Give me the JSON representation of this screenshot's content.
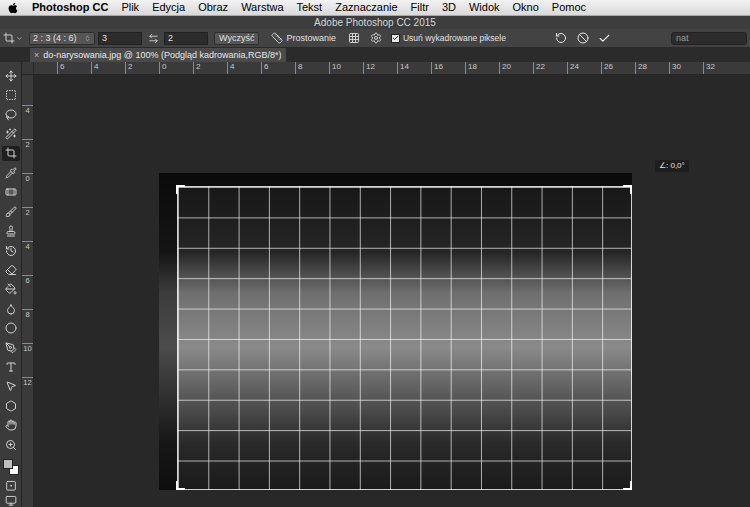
{
  "menu_bar": {
    "app_name": "Photoshop CC",
    "items": [
      "Plik",
      "Edycja",
      "Obraz",
      "Warstwa",
      "Tekst",
      "Zaznaczanie",
      "Filtr",
      "3D",
      "Widok",
      "Okno",
      "Pomoc"
    ]
  },
  "window": {
    "title": "Adobe Photoshop CC 2015"
  },
  "options_bar": {
    "ratio_preset": "2 : 3 (4 : 6)",
    "width": "3",
    "height": "2",
    "clear_button": "Wyczyść",
    "straighten_label": "Prostowanie",
    "delete_cropped": {
      "label": "Usuń wykadrowane piksele",
      "checked": true
    },
    "search": {
      "value": "nat"
    }
  },
  "document_tab": {
    "title": "do-narysowania.jpg @ 100% (Podgląd kadrowania,RGB/8*)",
    "close": "×",
    "selected": true
  },
  "rulers": {
    "horizontal": [
      "6",
      "4",
      "2",
      "0",
      "2",
      "4",
      "6",
      "8",
      "10",
      "12",
      "14",
      "16",
      "18",
      "20",
      "22",
      "24",
      "26",
      "28",
      "30",
      "32"
    ],
    "vertical": [
      "4",
      "2",
      "0",
      "2",
      "4",
      "6",
      "8",
      "10",
      "12"
    ]
  },
  "toolbar": {
    "tools": [
      {
        "selected": false
      },
      {
        "selected": false
      },
      {
        "selected": false
      },
      {
        "selected": false
      },
      {
        "selected": true
      },
      {
        "selected": false
      },
      {
        "selected": false
      },
      {
        "selected": false
      },
      {
        "selected": false
      },
      {
        "selected": false
      },
      {
        "selected": false
      },
      {
        "selected": false
      },
      {
        "selected": false
      },
      {
        "selected": false
      },
      {
        "selected": false
      },
      {
        "selected": false
      },
      {
        "selected": false
      },
      {
        "selected": false
      },
      {
        "selected": false
      },
      {
        "selected": false
      }
    ],
    "swatches": {
      "foreground": "#bdbdbd",
      "background": "#ffffff"
    }
  },
  "canvas": {
    "angle_readout": "∠: 0,0°"
  }
}
